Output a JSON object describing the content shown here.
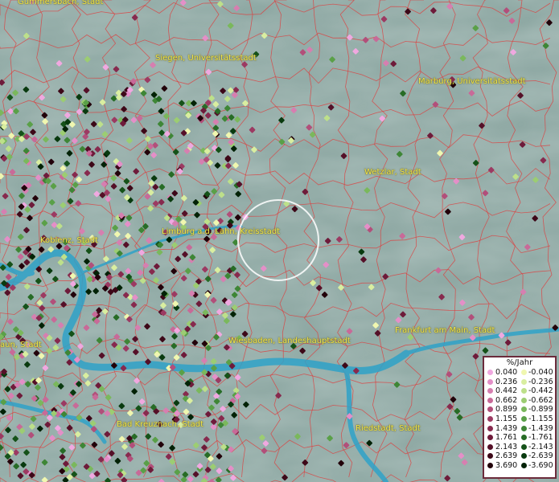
{
  "cities": [
    {
      "name": "Gummersbach, Stadt"
    },
    {
      "name": "Siegen, Universitätsstadt"
    },
    {
      "name": "Marburg, Universitätsstadt"
    },
    {
      "name": "Wetzlar, Stadt"
    },
    {
      "name": "Koblenz, Stadt"
    },
    {
      "name": "Limburg a.d. Lahn, Kreisstadt"
    },
    {
      "name": "Frankfurt am Main, Stadt"
    },
    {
      "name": "Wiesbaden, Landeshauptstadt"
    },
    {
      "name": "Bad Kreuznach, Stadt"
    },
    {
      "name": "Riedstadt, Stadt"
    },
    {
      "name": "aun, Stadt"
    }
  ],
  "legend": {
    "title": "%/Jahr",
    "positive": [
      {
        "value": "0.040",
        "color": "#f0a8e0"
      },
      {
        "value": "0.236",
        "color": "#e48fc8"
      },
      {
        "value": "0.442",
        "color": "#d67fb0"
      },
      {
        "value": "0.662",
        "color": "#c86a98"
      },
      {
        "value": "0.899",
        "color": "#b24f7a"
      },
      {
        "value": "1.155",
        "color": "#9c3a62"
      },
      {
        "value": "1.439",
        "color": "#872a4e"
      },
      {
        "value": "1.761",
        "color": "#6e1b3a"
      },
      {
        "value": "2.143",
        "color": "#551028"
      },
      {
        "value": "2.639",
        "color": "#3d0818"
      },
      {
        "value": "3.690",
        "color": "#22020a"
      }
    ],
    "negative": [
      {
        "value": "-0.040",
        "color": "#f0f7b0"
      },
      {
        "value": "-0.236",
        "color": "#d9eea0"
      },
      {
        "value": "-0.442",
        "color": "#bde08a"
      },
      {
        "value": "-0.662",
        "color": "#9ccd72"
      },
      {
        "value": "-0.899",
        "color": "#7ab85c"
      },
      {
        "value": "-1.155",
        "color": "#5aa048"
      },
      {
        "value": "-1.439",
        "color": "#3e8636"
      },
      {
        "value": "-1.761",
        "color": "#276c26"
      },
      {
        "value": "-2.143",
        "color": "#155219"
      },
      {
        "value": "-2.639",
        "color": "#093a0f"
      },
      {
        "value": "-3.690",
        "color": "#022206"
      }
    ]
  },
  "colors": {
    "terrain": "#8fa9a4",
    "river": "#2fa2c8",
    "boundary": "#e03a3a",
    "label": "#f2e64a",
    "legend_border": "#6b2b3b"
  }
}
